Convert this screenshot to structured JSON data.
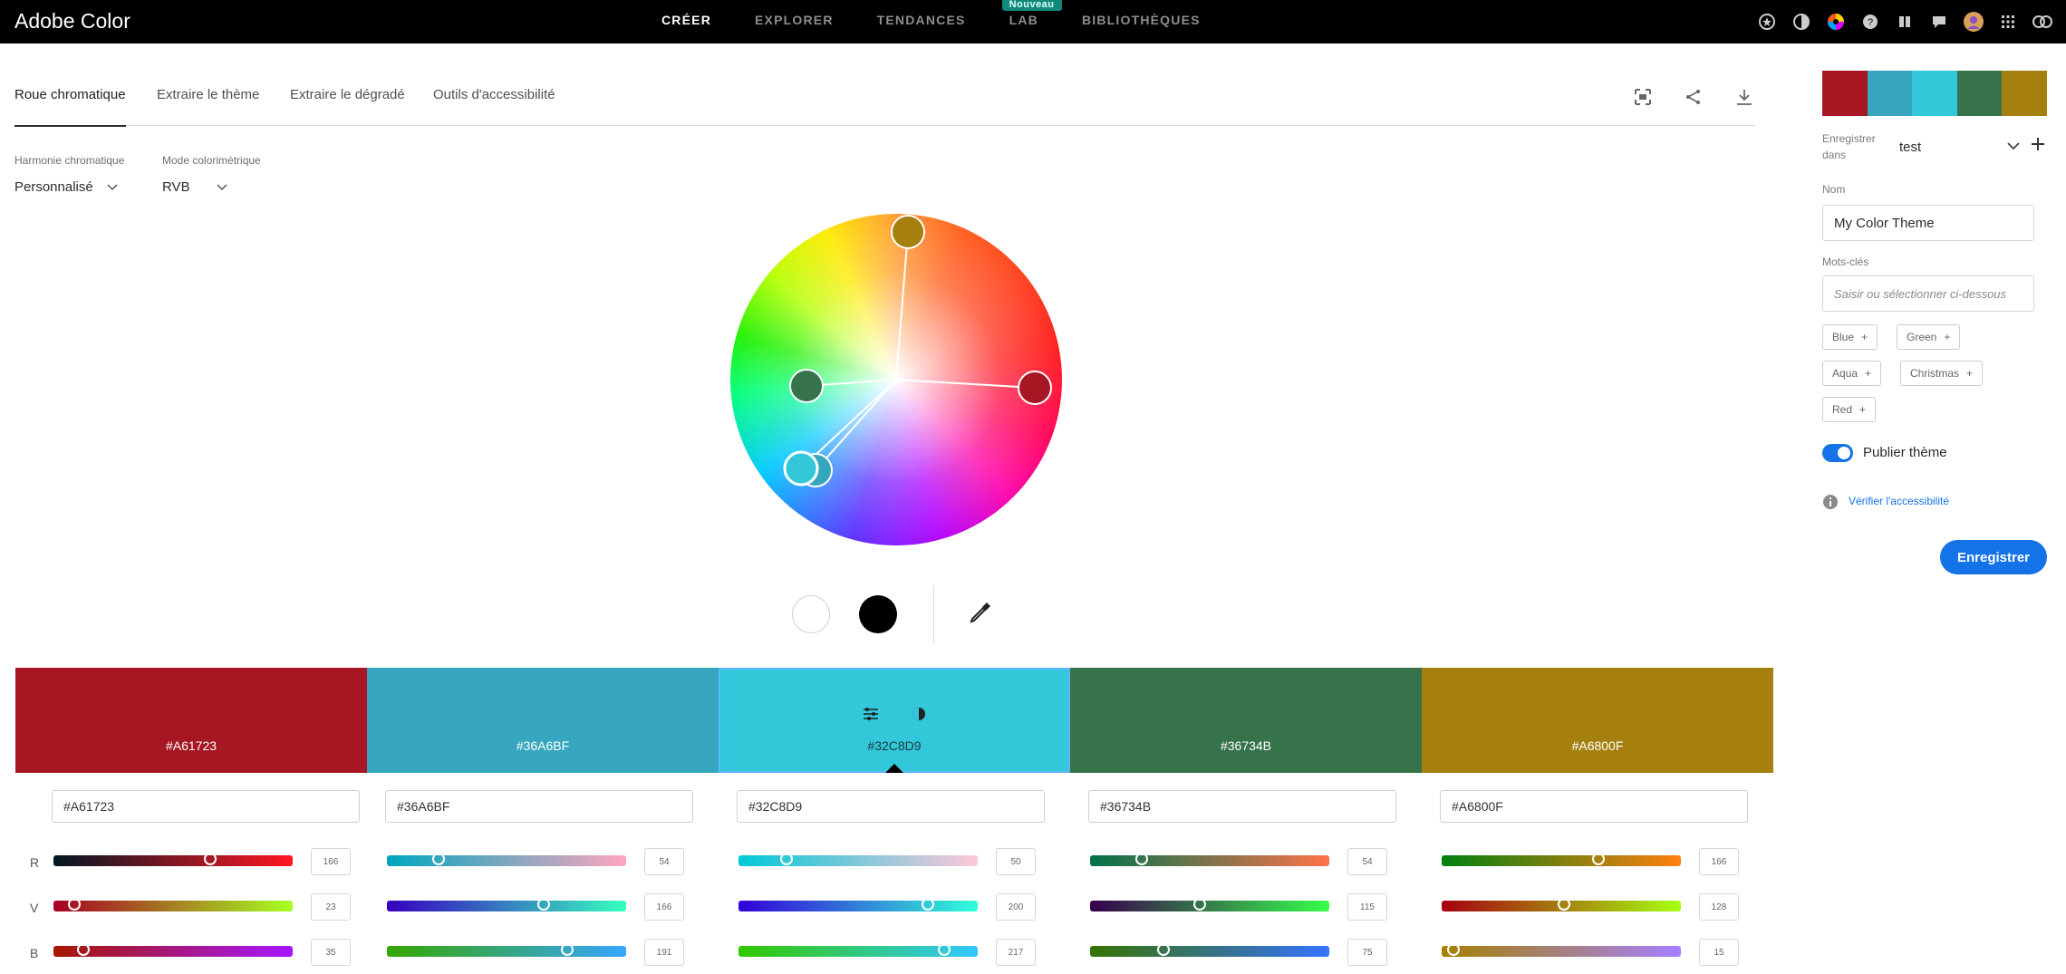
{
  "app": {
    "title": "Adobe Color"
  },
  "nav": {
    "items": [
      {
        "label": "CRÉER",
        "active": true
      },
      {
        "label": "EXPLORER"
      },
      {
        "label": "TENDANCES"
      },
      {
        "label": "LAB",
        "badge": "Nouveau"
      },
      {
        "label": "BIBLIOTHÈQUES"
      }
    ]
  },
  "tabs": [
    {
      "label": "Roue chromatique",
      "active": true
    },
    {
      "label": "Extraire le thème"
    },
    {
      "label": "Extraire le dégradé"
    },
    {
      "label": "Outils d'accessibilité"
    }
  ],
  "controls": {
    "harmony_label": "Harmonie chromatique",
    "harmony_value": "Personnalisé",
    "mode_label": "Mode colorimétrique",
    "mode_value": "RVB"
  },
  "swatches": [
    {
      "hex": "#A61723",
      "r": 166,
      "v": 23,
      "b": 35
    },
    {
      "hex": "#36A6BF",
      "r": 54,
      "v": 166,
      "b": 191
    },
    {
      "hex": "#32C8D9",
      "r": 50,
      "v": 200,
      "b": 217,
      "selected": true
    },
    {
      "hex": "#36734B",
      "r": 54,
      "v": 115,
      "b": 75
    },
    {
      "hex": "#A6800F",
      "r": 166,
      "v": 128,
      "b": 15
    }
  ],
  "channels": {
    "r": "R",
    "v": "V",
    "b": "B"
  },
  "panel": {
    "save_in_label": "Enregistrer dans",
    "library": "test",
    "name_label": "Nom",
    "name_value": "My Color Theme",
    "keywords_label": "Mots-clés",
    "keywords_placeholder": "Saisir ou sélectionner ci-dessous",
    "tags": [
      "Blue",
      "Green",
      "Aqua",
      "Christmas",
      "Red"
    ],
    "publish_label": "Publier thème",
    "accessibility_link": "Vérifier l'accessibilité",
    "save_button": "Enregistrer"
  },
  "colors": {
    "accent": "#1473e6"
  }
}
